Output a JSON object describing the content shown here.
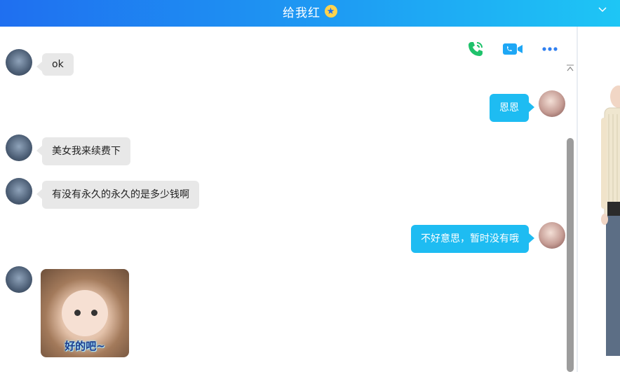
{
  "header": {
    "title": "给我红",
    "badge_icon": "star-badge-icon",
    "right_icon": "chevron-down-icon",
    "gradient": [
      "#1f6ff0",
      "#1ec6f5"
    ]
  },
  "toolbar": {
    "icons": [
      "phone-call-icon",
      "video-call-icon",
      "more-icon"
    ],
    "phone_color": "#1fc26b",
    "video_color": "#1ea7f5",
    "more_color": "#2f7ff0"
  },
  "messages": [
    {
      "side": "left",
      "text": "ok"
    },
    {
      "side": "right",
      "text": "恩恩"
    },
    {
      "side": "left",
      "text": "美女我来续费下"
    },
    {
      "side": "left",
      "text": "有没有永久的永久的是多少钱啊"
    },
    {
      "side": "right",
      "text": "不好意思，暂时没有哦"
    },
    {
      "side": "left",
      "type": "sticker",
      "caption": "好的吧~"
    }
  ],
  "colors": {
    "bubble_right": "#1ebcf2",
    "bubble_left": "#e8e8e8"
  }
}
